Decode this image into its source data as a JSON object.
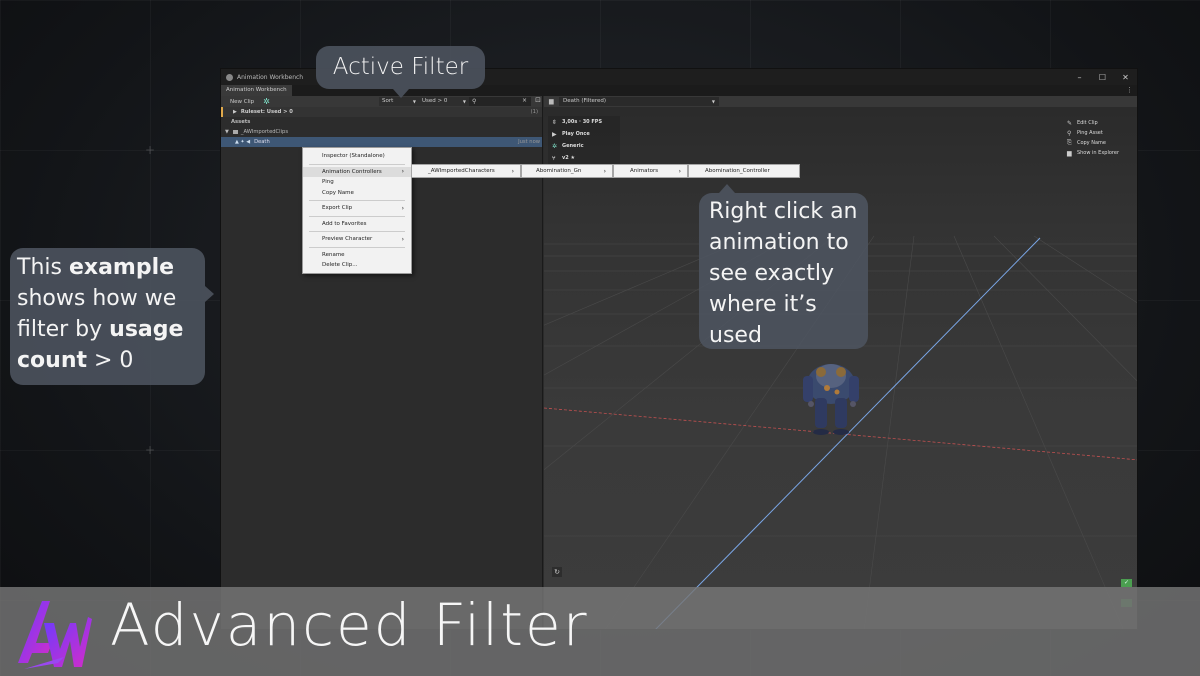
{
  "window": {
    "title": "Animation Workbench",
    "tab": "Animation Workbench",
    "controls": [
      "–",
      "☐",
      "✕"
    ],
    "menu_icon": "⋮"
  },
  "left_toolbar": {
    "new_clip": "New Clip",
    "sort": "Sort",
    "filter": "Used > 0",
    "search_icon": "search-icon",
    "clear": "×"
  },
  "tree": {
    "ruleset": "Ruleset: Used > 0",
    "ruleset_count": "(1)",
    "assets": "Assets",
    "folder": "_AWImportedClips",
    "clip": "Death",
    "clip_tag": "Just now"
  },
  "preview": {
    "dropdown": "Death (Filtered)",
    "info": [
      "3,00s · 30 FPS",
      "Play Once",
      "Generic",
      "v2 ★"
    ],
    "actions": [
      "Edit Clip",
      "Ping Asset",
      "Copy Name",
      "Show in Explorer"
    ]
  },
  "context_menu": {
    "items": [
      "Inspector (Standalone)",
      "Animation Controllers",
      "Ping",
      "Copy Name",
      "Export Clip",
      "Add to Favorites",
      "Preview Character",
      "Rename",
      "Delete Clip..."
    ]
  },
  "submenu_path": [
    "_AWImportedCharacters",
    "Abomination_Gn",
    "Animators",
    "Abomination_Controller"
  ],
  "callouts": {
    "active_filter": "Active Filter",
    "example": {
      "t1": "This ",
      "b1": "example",
      "t2": " shows how we filter by ",
      "b2": "usage count",
      "t3": " > 0"
    },
    "right_click": "Right click an animation to see exactly where it’s used"
  },
  "banner": {
    "title": "Advanced Filter",
    "logo": "AW"
  },
  "colors": {
    "accent_teal": "#7fe0c8",
    "ruleset_marker": "#e0a94b",
    "selected_row": "#3e5775",
    "bubble": "#4d5460",
    "banner": "#767676"
  }
}
